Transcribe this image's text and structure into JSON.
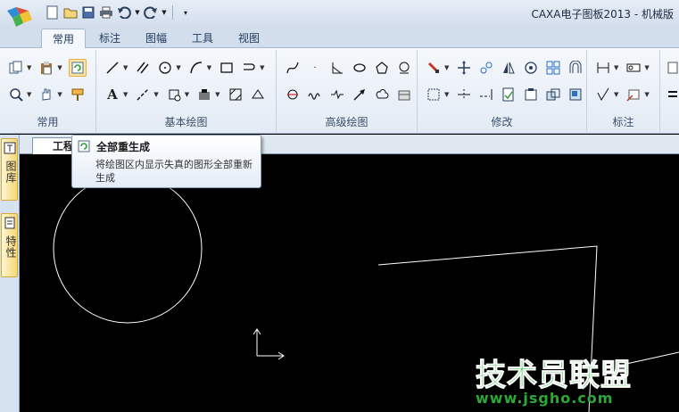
{
  "window": {
    "title": "CAXA电子图板2013 - 机械版"
  },
  "ribbon": {
    "tabs": [
      {
        "label": "常用",
        "active": true
      },
      {
        "label": "标注"
      },
      {
        "label": "图幅"
      },
      {
        "label": "工具"
      },
      {
        "label": "视图"
      }
    ],
    "groups": {
      "common": "常用",
      "basic_draw": "基本绘图",
      "advanced_draw": "高级绘图",
      "modify": "修改",
      "dimension": "标注"
    }
  },
  "left_dock": {
    "panels": [
      {
        "label": "图库"
      },
      {
        "label": "特性"
      }
    ]
  },
  "document": {
    "tab_label": "工程"
  },
  "tooltip": {
    "title": "全部重生成",
    "description": "将绘图区内显示失真的图形全部重新生成"
  },
  "watermark": {
    "line1": "技术员联盟",
    "line2": "www.jsgho.com"
  },
  "colors": {
    "canvas": "#000000",
    "entity": "#ffffff",
    "accent": "#1e395b",
    "watermark": "#1fc02f"
  }
}
